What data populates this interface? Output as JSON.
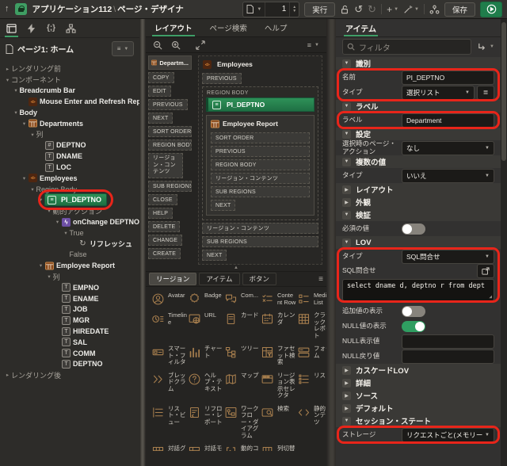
{
  "header": {
    "app_label": "アプリケーション112",
    "separator": "\\",
    "page_designer_label": "ページ・デザイナ",
    "page_number": "1",
    "run_button": "実行",
    "save_button": "保存",
    "icons": [
      "up-arrow",
      "application-icon",
      "page-select",
      "spinner",
      "run",
      "unlock",
      "undo",
      "redo",
      "create-plus",
      "utilities-wand",
      "team-dev",
      "save",
      "run-page-play"
    ]
  },
  "left_panel": {
    "page_title": "ページ1: ホーム",
    "tab_icons": [
      "rendering-tree",
      "dynamic-actions",
      "processing",
      "shared-components"
    ],
    "tree": [
      {
        "label": "レンダリング前",
        "level": 0,
        "chevron": "right",
        "muted": true
      },
      {
        "label": "コンポーネント",
        "level": 0,
        "chevron": "down",
        "muted": true
      },
      {
        "label": "Breadcrumb Bar",
        "level": 1,
        "chevron": "down"
      },
      {
        "label": "Mouse Enter and Refresh Report",
        "level": 2,
        "icon": "code"
      },
      {
        "label": "Body",
        "level": 1,
        "chevron": "down"
      },
      {
        "label": "Departments",
        "level": 2,
        "chevron": "down",
        "icon": "report"
      },
      {
        "label": "列",
        "level": 3,
        "chevron": "down",
        "muted": true
      },
      {
        "label": "DEPTNO",
        "level": 4,
        "icon": "numcol"
      },
      {
        "label": "DNAME",
        "level": 4,
        "icon": "textcol"
      },
      {
        "label": "LOC",
        "level": 4,
        "icon": "textcol"
      },
      {
        "label": "Employees",
        "level": 2,
        "chevron": "down",
        "icon": "code"
      },
      {
        "label": "Region Body",
        "level": 3,
        "chevron": "down",
        "muted": true
      },
      {
        "label": "PI_DEPTNO",
        "level": 4,
        "chevron": "down",
        "icon": "select",
        "selected": true,
        "annotated": true
      },
      {
        "label": "動的アクション",
        "level": 5,
        "chevron": "down",
        "muted": true
      },
      {
        "label": "onChange DEPTNO",
        "level": 6,
        "chevron": "down",
        "icon": "bolt"
      },
      {
        "label": "True",
        "level": 7,
        "chevron": "down",
        "muted": true
      },
      {
        "label": "リフレッシュ",
        "level": 8,
        "icon": "refresh"
      },
      {
        "label": "False",
        "level": 7,
        "muted": true
      },
      {
        "label": "Employee Report",
        "level": 4,
        "chevron": "down",
        "icon": "report"
      },
      {
        "label": "列",
        "level": 5,
        "chevron": "down",
        "muted": true
      },
      {
        "label": "EMPNO",
        "level": 6,
        "icon": "textcol"
      },
      {
        "label": "ENAME",
        "level": 6,
        "icon": "textcol"
      },
      {
        "label": "JOB",
        "level": 6,
        "icon": "textcol"
      },
      {
        "label": "MGR",
        "level": 6,
        "icon": "textcol"
      },
      {
        "label": "HIREDATE",
        "level": 6,
        "icon": "textcol"
      },
      {
        "label": "SAL",
        "level": 6,
        "icon": "textcol"
      },
      {
        "label": "COMM",
        "level": 6,
        "icon": "textcol"
      },
      {
        "label": "DEPTNO",
        "level": 6,
        "icon": "textcol"
      },
      {
        "label": "レンダリング後",
        "level": 0,
        "chevron": "right",
        "muted": true
      }
    ]
  },
  "middle_panel": {
    "tabs": [
      {
        "label": "レイアウト",
        "active": true
      },
      {
        "label": "ページ検索",
        "active": false
      },
      {
        "label": "ヘルプ",
        "active": false
      }
    ],
    "toolbar_icons": [
      "zoom-out",
      "zoom-in",
      "fit-to-window",
      "menu"
    ],
    "layout": {
      "departments": {
        "title": "Departm...",
        "slots": [
          "COPY",
          "EDIT",
          "PREVIOUS",
          "NEXT",
          "SORT ORDER",
          "REGION BODY",
          "リージョン・コンテンツ",
          "SUB REGIONS",
          "CLOSE",
          "HELP",
          "DELETE",
          "CHANGE",
          "CREATE"
        ]
      },
      "employees": {
        "title": "Employees",
        "previous_slot": "PREVIOUS",
        "region_body_label": "REGION BODY",
        "selected_item": "PI_DEPTNO",
        "report": {
          "title": "Employee Report",
          "slots": [
            "SORT ORDER",
            "PREVIOUS",
            "REGION BODY",
            "リージョン・コンテンツ",
            "SUB REGIONS",
            "NEXT"
          ]
        },
        "trailing_slots": [
          "リージョン・コンテンツ",
          "SUB REGIONS",
          "NEXT"
        ]
      }
    },
    "gallery_tabs": [
      {
        "label": "リージョン",
        "active": true
      },
      {
        "label": "アイテム",
        "active": false
      },
      {
        "label": "ボタン",
        "active": false
      }
    ],
    "gallery": [
      {
        "label": "Avatar",
        "icon": "avatar"
      },
      {
        "label": "Badge",
        "icon": "badge"
      },
      {
        "label": "Com...",
        "icon": "comments"
      },
      {
        "label": "Content Row",
        "icon": "content-row"
      },
      {
        "label": "Media List",
        "icon": "media-list"
      },
      {
        "label": "Timeline",
        "icon": "timeline"
      },
      {
        "label": "URL",
        "icon": "url"
      },
      {
        "label": "カード",
        "icon": "card"
      },
      {
        "label": "カレンダ",
        "icon": "calendar"
      },
      {
        "label": "クラシック・レポート",
        "icon": "classic-report"
      },
      {
        "label": "スマート・フィルタ",
        "icon": "smart-filter"
      },
      {
        "label": "チャート",
        "icon": "chart"
      },
      {
        "label": "ツリー",
        "icon": "tree"
      },
      {
        "label": "ファセット検索",
        "icon": "faceted-search"
      },
      {
        "label": "フォーム",
        "icon": "form"
      },
      {
        "label": "ブレッドクラム",
        "icon": "breadcrumb"
      },
      {
        "label": "ヘルプ・テキスト",
        "icon": "help-text"
      },
      {
        "label": "マップ",
        "icon": "map"
      },
      {
        "label": "リージョン表示セレクタ",
        "icon": "region-display-selector"
      },
      {
        "label": "リスト",
        "icon": "list"
      },
      {
        "label": "リスト・ビュー",
        "icon": "list-view"
      },
      {
        "label": "リフロー・レポート",
        "icon": "reflow-report"
      },
      {
        "label": "ワークフロー・ダイアグラム",
        "icon": "workflow-diagram"
      },
      {
        "label": "検索",
        "icon": "search"
      },
      {
        "label": "静的コンテンツ",
        "icon": "static-content"
      },
      {
        "label": "対話グリッド",
        "icon": "interactive-grid"
      },
      {
        "label": "対話モード・レポート",
        "icon": "interactive-report"
      },
      {
        "label": "動的コンテンツ",
        "icon": "dynamic-content"
      },
      {
        "label": "列切替えレポート",
        "icon": "column-toggle-report"
      }
    ]
  },
  "right_panel": {
    "tab": "アイテム",
    "filter_placeholder": "フィルタ",
    "sections": [
      {
        "label": "識別",
        "expanded": true,
        "annotation": {
          "from": 0,
          "to": 1
        },
        "rows": [
          {
            "label": "名前",
            "type": "input",
            "value": "PI_DEPTNO"
          },
          {
            "label": "タイプ",
            "type": "select",
            "value": "選択リスト",
            "list_button": true
          }
        ]
      },
      {
        "label": "ラベル",
        "expanded": true,
        "annotation": {
          "from": 0,
          "to": 0
        },
        "rows": [
          {
            "label": "ラベル",
            "type": "input",
            "value": "Department"
          }
        ]
      },
      {
        "label": "設定",
        "expanded": true,
        "rows": [
          {
            "label": "選択時のページ・アクション",
            "type": "select",
            "value": "なし",
            "tall": true
          }
        ]
      },
      {
        "label": "複数の値",
        "expanded": true,
        "rows": [
          {
            "label": "タイプ",
            "type": "select",
            "value": "いいえ"
          }
        ]
      },
      {
        "label": "レイアウト",
        "expanded": false,
        "rows": []
      },
      {
        "label": "外観",
        "expanded": false,
        "rows": []
      },
      {
        "label": "検証",
        "expanded": true,
        "rows": [
          {
            "label": "必須の値",
            "type": "toggle",
            "value": false
          }
        ]
      },
      {
        "label": "LOV",
        "expanded": true,
        "annotation": {
          "from": 0,
          "to": 1
        },
        "rows": [
          {
            "label": "タイプ",
            "type": "select",
            "value": "SQL問合せ"
          },
          {
            "label": "SQL問合せ",
            "type": "code",
            "value": "select dname d, deptno r from dept"
          },
          {
            "label": "追加値の表示",
            "type": "toggle",
            "value": false
          },
          {
            "label": "NULL値の表示",
            "type": "toggle",
            "value": true
          },
          {
            "label": "NULL表示値",
            "type": "input",
            "value": ""
          },
          {
            "label": "NULL戻り値",
            "type": "input",
            "value": ""
          }
        ]
      },
      {
        "label": "カスケードLOV",
        "expanded": false,
        "rows": []
      },
      {
        "label": "詳細",
        "expanded": false,
        "rows": []
      },
      {
        "label": "ソース",
        "expanded": false,
        "rows": []
      },
      {
        "label": "デフォルト",
        "expanded": false,
        "rows": []
      },
      {
        "label": "セッション・ステート",
        "expanded": true,
        "annotation": {
          "from": 0,
          "to": 0
        },
        "rows": [
          {
            "label": "ストレージ",
            "type": "select",
            "value": "リクエストごと(メモリーのみ)"
          }
        ]
      }
    ]
  },
  "colors": {
    "accent_green": "#3f9e67",
    "selection_green": "#1f7044",
    "annotation_red": "#e8251a",
    "gallery_icon": "#a87f4e",
    "header_bg": "#343330",
    "panel_bg": "#2d2c29"
  }
}
